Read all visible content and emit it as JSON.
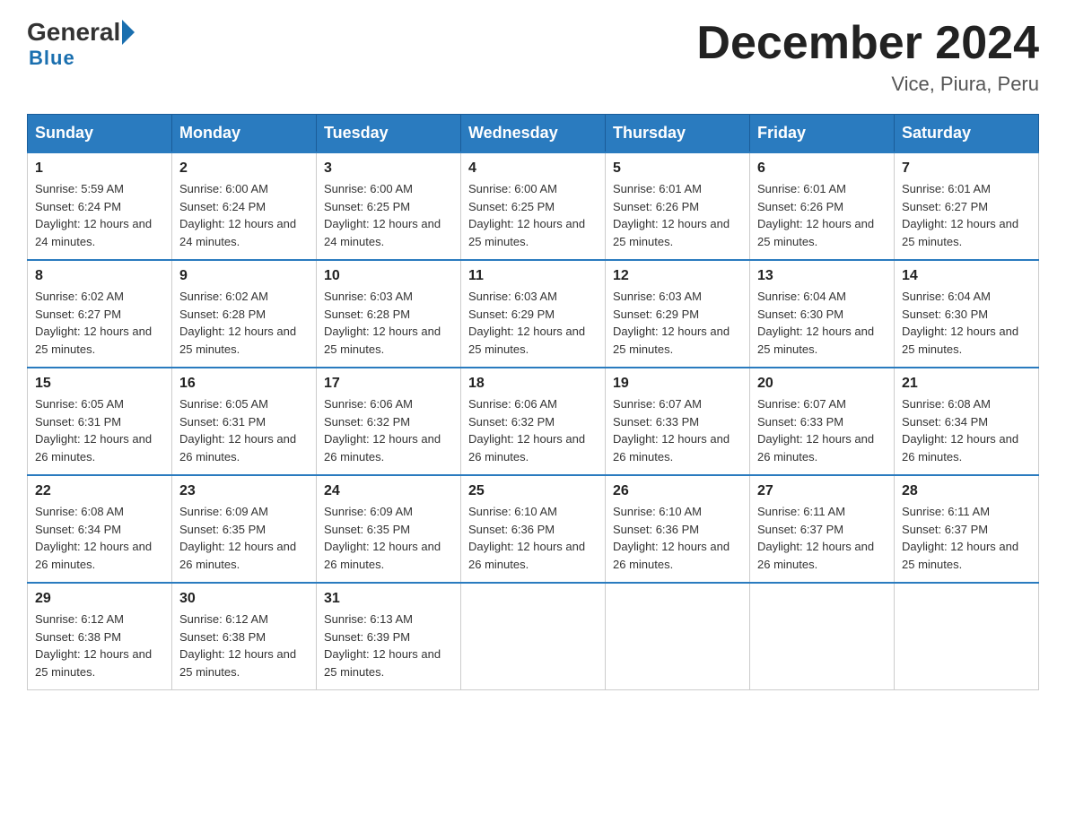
{
  "header": {
    "logo_general": "General",
    "logo_blue": "Blue",
    "month_title": "December 2024",
    "subtitle": "Vice, Piura, Peru"
  },
  "days_of_week": [
    "Sunday",
    "Monday",
    "Tuesday",
    "Wednesday",
    "Thursday",
    "Friday",
    "Saturday"
  ],
  "weeks": [
    [
      {
        "num": "1",
        "sunrise": "5:59 AM",
        "sunset": "6:24 PM",
        "daylight": "12 hours and 24 minutes."
      },
      {
        "num": "2",
        "sunrise": "6:00 AM",
        "sunset": "6:24 PM",
        "daylight": "12 hours and 24 minutes."
      },
      {
        "num": "3",
        "sunrise": "6:00 AM",
        "sunset": "6:25 PM",
        "daylight": "12 hours and 24 minutes."
      },
      {
        "num": "4",
        "sunrise": "6:00 AM",
        "sunset": "6:25 PM",
        "daylight": "12 hours and 25 minutes."
      },
      {
        "num": "5",
        "sunrise": "6:01 AM",
        "sunset": "6:26 PM",
        "daylight": "12 hours and 25 minutes."
      },
      {
        "num": "6",
        "sunrise": "6:01 AM",
        "sunset": "6:26 PM",
        "daylight": "12 hours and 25 minutes."
      },
      {
        "num": "7",
        "sunrise": "6:01 AM",
        "sunset": "6:27 PM",
        "daylight": "12 hours and 25 minutes."
      }
    ],
    [
      {
        "num": "8",
        "sunrise": "6:02 AM",
        "sunset": "6:27 PM",
        "daylight": "12 hours and 25 minutes."
      },
      {
        "num": "9",
        "sunrise": "6:02 AM",
        "sunset": "6:28 PM",
        "daylight": "12 hours and 25 minutes."
      },
      {
        "num": "10",
        "sunrise": "6:03 AM",
        "sunset": "6:28 PM",
        "daylight": "12 hours and 25 minutes."
      },
      {
        "num": "11",
        "sunrise": "6:03 AM",
        "sunset": "6:29 PM",
        "daylight": "12 hours and 25 minutes."
      },
      {
        "num": "12",
        "sunrise": "6:03 AM",
        "sunset": "6:29 PM",
        "daylight": "12 hours and 25 minutes."
      },
      {
        "num": "13",
        "sunrise": "6:04 AM",
        "sunset": "6:30 PM",
        "daylight": "12 hours and 25 minutes."
      },
      {
        "num": "14",
        "sunrise": "6:04 AM",
        "sunset": "6:30 PM",
        "daylight": "12 hours and 25 minutes."
      }
    ],
    [
      {
        "num": "15",
        "sunrise": "6:05 AM",
        "sunset": "6:31 PM",
        "daylight": "12 hours and 26 minutes."
      },
      {
        "num": "16",
        "sunrise": "6:05 AM",
        "sunset": "6:31 PM",
        "daylight": "12 hours and 26 minutes."
      },
      {
        "num": "17",
        "sunrise": "6:06 AM",
        "sunset": "6:32 PM",
        "daylight": "12 hours and 26 minutes."
      },
      {
        "num": "18",
        "sunrise": "6:06 AM",
        "sunset": "6:32 PM",
        "daylight": "12 hours and 26 minutes."
      },
      {
        "num": "19",
        "sunrise": "6:07 AM",
        "sunset": "6:33 PM",
        "daylight": "12 hours and 26 minutes."
      },
      {
        "num": "20",
        "sunrise": "6:07 AM",
        "sunset": "6:33 PM",
        "daylight": "12 hours and 26 minutes."
      },
      {
        "num": "21",
        "sunrise": "6:08 AM",
        "sunset": "6:34 PM",
        "daylight": "12 hours and 26 minutes."
      }
    ],
    [
      {
        "num": "22",
        "sunrise": "6:08 AM",
        "sunset": "6:34 PM",
        "daylight": "12 hours and 26 minutes."
      },
      {
        "num": "23",
        "sunrise": "6:09 AM",
        "sunset": "6:35 PM",
        "daylight": "12 hours and 26 minutes."
      },
      {
        "num": "24",
        "sunrise": "6:09 AM",
        "sunset": "6:35 PM",
        "daylight": "12 hours and 26 minutes."
      },
      {
        "num": "25",
        "sunrise": "6:10 AM",
        "sunset": "6:36 PM",
        "daylight": "12 hours and 26 minutes."
      },
      {
        "num": "26",
        "sunrise": "6:10 AM",
        "sunset": "6:36 PM",
        "daylight": "12 hours and 26 minutes."
      },
      {
        "num": "27",
        "sunrise": "6:11 AM",
        "sunset": "6:37 PM",
        "daylight": "12 hours and 26 minutes."
      },
      {
        "num": "28",
        "sunrise": "6:11 AM",
        "sunset": "6:37 PM",
        "daylight": "12 hours and 25 minutes."
      }
    ],
    [
      {
        "num": "29",
        "sunrise": "6:12 AM",
        "sunset": "6:38 PM",
        "daylight": "12 hours and 25 minutes."
      },
      {
        "num": "30",
        "sunrise": "6:12 AM",
        "sunset": "6:38 PM",
        "daylight": "12 hours and 25 minutes."
      },
      {
        "num": "31",
        "sunrise": "6:13 AM",
        "sunset": "6:39 PM",
        "daylight": "12 hours and 25 minutes."
      },
      null,
      null,
      null,
      null
    ]
  ],
  "labels": {
    "sunrise_prefix": "Sunrise: ",
    "sunset_prefix": "Sunset: ",
    "daylight_prefix": "Daylight: "
  }
}
